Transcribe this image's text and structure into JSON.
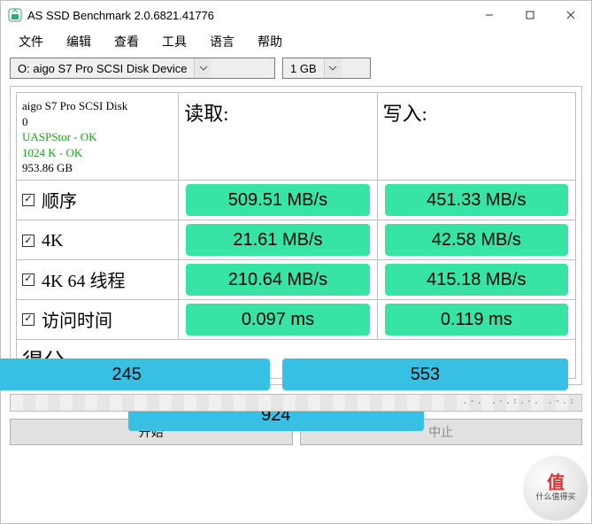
{
  "window": {
    "title": "AS SSD Benchmark 2.0.6821.41776"
  },
  "menu": {
    "file": "文件",
    "edit": "编辑",
    "view": "查看",
    "tools": "工具",
    "lang": "语言",
    "help": "帮助"
  },
  "controls": {
    "device_selected": "O: aigo S7 Pro SCSI Disk Device",
    "size_selected": "1 GB"
  },
  "info": {
    "device_name": "aigo S7 Pro SCSI Disk",
    "device_index": "0",
    "driver_line": "UASPStor - OK",
    "align_line": "1024 K - OK",
    "capacity": "953.86 GB"
  },
  "headers": {
    "read": "读取:",
    "write": "写入:"
  },
  "rows": {
    "seq": {
      "label": "顺序",
      "read": "509.51 MB/s",
      "write": "451.33 MB/s"
    },
    "fourk": {
      "label": "4K",
      "read": "21.61 MB/s",
      "write": "42.58 MB/s"
    },
    "fourk64": {
      "label": "4K 64 线程",
      "read": "210.64 MB/s",
      "write": "415.18 MB/s"
    },
    "access": {
      "label": "访问时间",
      "read": "0.097 ms",
      "write": "0.119 ms"
    }
  },
  "score": {
    "label": "得分:",
    "read": "245",
    "write": "553",
    "total": "924"
  },
  "buttons": {
    "start": "开始",
    "stop": "中止"
  },
  "watermark": {
    "glyph": "值",
    "line": "什么值得买"
  }
}
